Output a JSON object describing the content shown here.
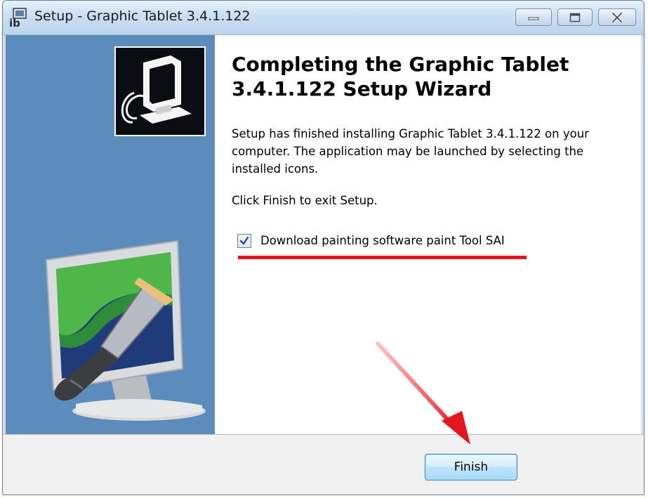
{
  "window": {
    "title": "Setup - Graphic Tablet 3.4.1.122"
  },
  "main": {
    "heading": "Completing the Graphic Tablet 3.4.1.122 Setup Wizard",
    "paragraph1": "Setup has finished installing Graphic Tablet 3.4.1.122 on your computer. The application may be launched by selecting the installed icons.",
    "paragraph2": "Click Finish to exit Setup.",
    "checkbox": {
      "label": "Download painting software paint Tool SAI",
      "checked": true
    }
  },
  "footer": {
    "finish_label": "Finish"
  },
  "icons": [
    "setup-app-icon",
    "minimize-icon",
    "maximize-icon",
    "close-icon",
    "tablet-logo-icon",
    "monitor-paintbrush-illustration",
    "checkmark-icon"
  ],
  "colors": {
    "left_panel": "#5c8cbc",
    "annotation_red": "#e3161d"
  }
}
